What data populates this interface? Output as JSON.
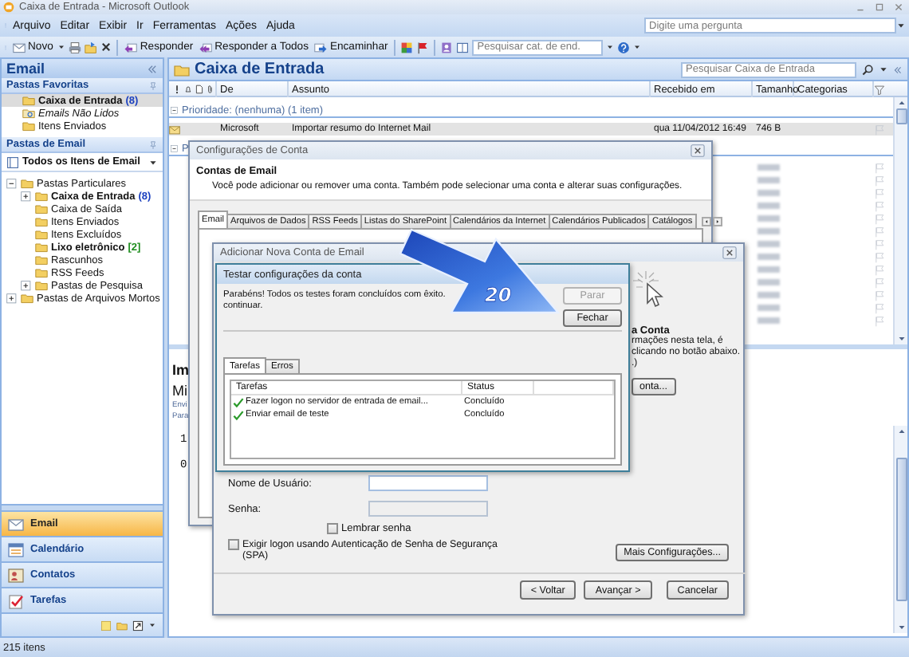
{
  "window": {
    "title": "Caixa de Entrada - Microsoft Outlook"
  },
  "menu": [
    "Arquivo",
    "Editar",
    "Exibir",
    "Ir",
    "Ferramentas",
    "Ações",
    "Ajuda"
  ],
  "help_search": {
    "placeholder": "Digite uma pergunta"
  },
  "toolbar": {
    "buttons": [
      "Novo",
      "Responder",
      "Responder a Todos",
      "Encaminhar"
    ],
    "address_search": {
      "placeholder": "Pesquisar cat. de end."
    }
  },
  "navigation": {
    "title": "Email",
    "favorites": {
      "title": "Pastas Favoritas",
      "items": [
        {
          "label": "Caixa de Entrada",
          "count": "(8)",
          "kind": "folder",
          "unread": true,
          "selected": true
        },
        {
          "label": "Emails Não Lidos",
          "kind": "search",
          "unread": false,
          "selected": false
        },
        {
          "label": "Itens Enviados",
          "kind": "folder",
          "unread": false,
          "selected": false
        }
      ]
    },
    "mail_folders": {
      "title": "Pastas de Email",
      "view": "Todos os Itens de Email",
      "tree": [
        {
          "label": "Pastas Particulares",
          "expanded": true,
          "unread": false,
          "children": [
            {
              "label": "Caixa de Entrada",
              "count": "(8)",
              "total_count": false,
              "expanded": false,
              "unread": true
            },
            {
              "label": "Caixa de Saída",
              "unread": false
            },
            {
              "label": "Itens Enviados",
              "unread": false
            },
            {
              "label": "Itens Excluídos",
              "unread": false
            },
            {
              "label": "Lixo eletrônico",
              "count": "[2]",
              "total_count": true,
              "unread": true
            },
            {
              "label": "Rascunhos",
              "unread": false
            },
            {
              "label": "RSS Feeds",
              "unread": false
            },
            {
              "label": "Pastas de Pesquisa",
              "expanded": false,
              "unread": false
            }
          ]
        },
        {
          "label": "Pastas de Arquivos Mortos",
          "expanded": false,
          "unread": false
        }
      ]
    },
    "buttons": [
      {
        "label": "Email",
        "selected": true
      },
      {
        "label": "Calendário",
        "selected": false
      },
      {
        "label": "Contatos",
        "selected": false
      },
      {
        "label": "Tarefas",
        "selected": false
      }
    ]
  },
  "mail": {
    "title": "Caixa de Entrada",
    "search": {
      "placeholder": "Pesquisar Caixa de Entrada"
    },
    "columns": [
      "De",
      "Assunto",
      "Recebido em",
      "Tamanho",
      "Categorias"
    ],
    "groups": [
      {
        "label": "Prioridade: (nenhuma) (1 item)",
        "expanded": true,
        "rows": [
          {
            "kind": "message",
            "from": "Microsoft",
            "subject": "Importar resumo do Internet Mail",
            "received": "qua 11/04/2012 16:49",
            "size": "746 B",
            "selected": true
          }
        ]
      },
      {
        "label": "P",
        "expanded": true,
        "rows": [
          {
            "kind": "blurred"
          },
          {
            "kind": "blurred"
          },
          {
            "kind": "blurred"
          },
          {
            "kind": "blurred"
          },
          {
            "kind": "blurred"
          },
          {
            "kind": "blurred"
          },
          {
            "kind": "blurred"
          },
          {
            "kind": "blurred"
          },
          {
            "kind": "blurred"
          },
          {
            "kind": "blurred"
          },
          {
            "kind": "blurred"
          },
          {
            "kind": "blurred"
          },
          {
            "kind": "blurred"
          }
        ]
      }
    ],
    "reading_pane": {
      "subject": "Im",
      "from": "Mi",
      "details": [
        "Envi",
        "Para"
      ],
      "body": [
        "1",
        "0"
      ]
    }
  },
  "status_bar": "215 itens",
  "account_settings": {
    "title": "Configurações de Conta",
    "heading": "Contas de Email",
    "description": "Você pode adicionar ou remover uma conta. Também pode selecionar uma conta e alterar suas configurações.",
    "tabs": [
      {
        "label": "Email",
        "selected": true
      },
      {
        "label": "Arquivos de Dados",
        "selected": false
      },
      {
        "label": "RSS Feeds",
        "selected": false
      },
      {
        "label": "Listas do SharePoint",
        "selected": false
      },
      {
        "label": "Calendários da Internet",
        "selected": false
      },
      {
        "label": "Calendários Publicados",
        "selected": false
      },
      {
        "label": "Catálogos",
        "selected": false
      }
    ]
  },
  "add_account": {
    "title": "Adicionar Nova Conta de Email",
    "side_heading": "a Conta",
    "side_lines": [
      "rmações nesta tela, é",
      "clicando no botão abaixo.",
      ".)"
    ],
    "side_button": "onta...",
    "username": {
      "label": "Nome de Usuário:",
      "disabled": false
    },
    "password": {
      "label": "Senha:",
      "disabled": true
    },
    "remember": {
      "label": "Lembrar senha",
      "checked": false
    },
    "spa": {
      "label": "Exigir logon usando Autenticação de Senha de Segurança (SPA)",
      "checked": false
    },
    "more_button": "Mais Configurações...",
    "buttons": [
      "< Voltar",
      "Avançar >",
      "Cancelar"
    ]
  },
  "test_dialog": {
    "title": "Testar configurações da conta",
    "message": "Parabéns! Todos os testes foram concluídos com êxito.",
    "message_end": "continuar.",
    "buttons": [
      {
        "label": "Parar",
        "disabled": true
      },
      {
        "label": "Fechar",
        "disabled": false
      }
    ],
    "tabs": [
      {
        "label": "Tarefas",
        "selected": true
      },
      {
        "label": "Erros",
        "selected": false
      }
    ],
    "columns": [
      "Tarefas",
      "Status"
    ],
    "tasks": [
      {
        "task": "Fazer logon no servidor de entrada de email...",
        "status": "Concluído",
        "done": true
      },
      {
        "task": "Enviar email de teste",
        "status": "Concluído",
        "done": true
      }
    ]
  },
  "callout": {
    "label": "20"
  }
}
